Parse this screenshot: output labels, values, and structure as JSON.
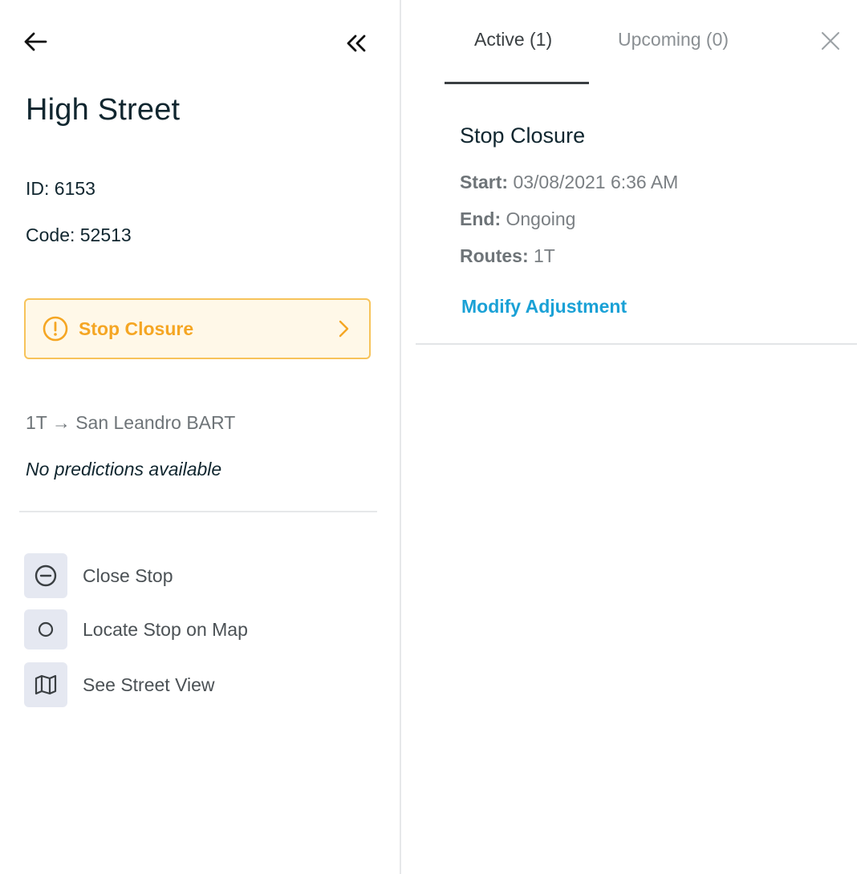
{
  "left_panel": {
    "back_icon": "arrow-left-icon",
    "collapse_icon": "double-chevron-left-icon",
    "stop_name": "High Street",
    "id_text": "ID: 6153",
    "code_text": "Code: 52513",
    "alert": {
      "label": "Stop Closure",
      "icon": "warning-circle-icon",
      "chevron_icon": "chevron-right-icon",
      "accent_color": "#f5a623",
      "border_color": "#f7c35a",
      "background": "#fff8e8"
    },
    "route_line": "1T → San Leandro BART",
    "predictions": "No predictions available",
    "actions": [
      {
        "label": "Close Stop",
        "icon": "minus-circle-icon"
      },
      {
        "label": "Locate Stop on Map",
        "icon": "circle-icon"
      },
      {
        "label": "See Street View",
        "icon": "map-icon"
      }
    ]
  },
  "right_panel": {
    "tabs": [
      {
        "label": "Active (1)",
        "selected": true
      },
      {
        "label": "Upcoming (0)",
        "selected": false
      }
    ],
    "close_icon": "close-icon",
    "adjustment": {
      "title": "Stop Closure",
      "start_label": "Start:",
      "start_value": "03/08/2021 6:36 AM",
      "end_label": "End:",
      "end_value": "Ongoing",
      "routes_label": "Routes:",
      "routes_value": "1T",
      "modify_label": "Modify Adjustment",
      "link_color": "#1aa1d6"
    }
  }
}
